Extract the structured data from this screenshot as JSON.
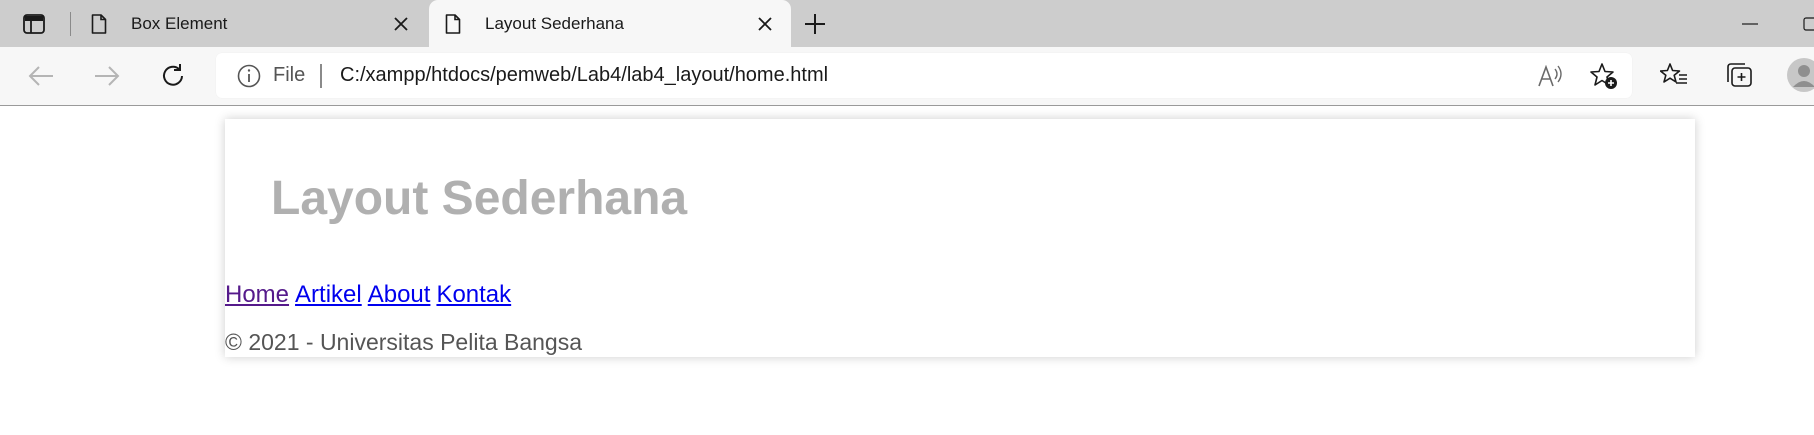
{
  "browser": {
    "tabs": [
      {
        "title": "Box Element",
        "active": false,
        "icon": "page-icon"
      },
      {
        "title": "Layout Sederhana",
        "active": true,
        "icon": "page-icon"
      }
    ],
    "address": {
      "scheme_label": "File",
      "url": "C:/xampp/htdocs/pemweb/Lab4/lab4_layout/home.html"
    }
  },
  "page": {
    "title": "Layout Sederhana",
    "title_color": "#b0b0b0",
    "nav": [
      {
        "label": "Home",
        "state": "visited",
        "color": "#551a8b"
      },
      {
        "label": "Artikel",
        "state": "unvisited",
        "color": "#0000ee"
      },
      {
        "label": "About",
        "state": "unvisited",
        "color": "#0000ee"
      },
      {
        "label": "Kontak",
        "state": "unvisited",
        "color": "#0000ee"
      }
    ],
    "footer": "© 2021 - Universitas Pelita Bangsa"
  }
}
